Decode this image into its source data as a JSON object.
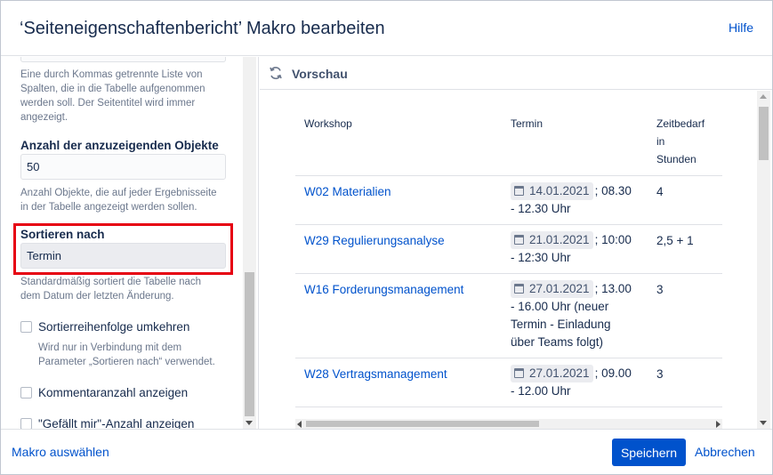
{
  "dialog": {
    "title": "‘Seiteneigenschaftenbericht’ Makro bearbeiten",
    "help": "Hilfe"
  },
  "left": {
    "columns_help_1": "Eine durch Kommas getrennte Liste von",
    "columns_help_2": "Spalten, die in die Tabelle aufgenommen",
    "columns_help_3": "werden soll. Der Seitentitel wird immer",
    "columns_help_4": "angezeigt.",
    "count_label": "Anzahl der anzuzeigenden Objekte",
    "count_value": "50",
    "count_help_1": "Anzahl Objekte, die auf jeder Ergebnisseite",
    "count_help_2": "in der Tabelle angezeigt werden sollen.",
    "sort_label": "Sortieren nach",
    "sort_value": "Termin",
    "sort_help_1": "Standardmäßig sortiert die Tabelle nach",
    "sort_help_2": "dem Datum der letzten Änderung.",
    "reverse_label": "Sortierreihenfolge umkehren",
    "reverse_help_1": "Wird nur in Verbindung mit dem",
    "reverse_help_2": "Parameter „Sortieren nach“ verwendet.",
    "comments_label": "Kommentaranzahl anzeigen",
    "likes_label": "\"Gefällt mir\"-Anzahl anzeigen"
  },
  "preview": {
    "title": "Vorschau",
    "headers": {
      "workshop": "Workshop",
      "termin": "Termin",
      "zeit_1": "Zeitbedarf",
      "zeit_2": "in",
      "zeit_3": "Stunden"
    },
    "rows": [
      {
        "workshop": "W02 Materialien",
        "date": "14.01.2021",
        "rest_1": "; 08.30",
        "rest_2": "- 12.30 Uhr",
        "rest_3": "",
        "rest_4": "",
        "hours": "4"
      },
      {
        "workshop": "W29 Regulierungsanalyse",
        "date": "21.01.2021",
        "rest_1": "; 10:00",
        "rest_2": "- 12:30 Uhr",
        "rest_3": "",
        "rest_4": "",
        "hours": "2,5 + 1"
      },
      {
        "workshop": "W16 Forderungsmanagement",
        "date": "27.01.2021",
        "rest_1": "; 13.00",
        "rest_2": "- 16.00 Uhr (neuer",
        "rest_3": "Termin - Einladung",
        "rest_4": "über Teams folgt)",
        "hours": "3"
      },
      {
        "workshop": "W28 Vertragsmanagement",
        "date": "27.01.2021",
        "rest_1": "; 09.00",
        "rest_2": "- 12.00 Uhr",
        "rest_3": "",
        "rest_4": "",
        "hours": "3"
      }
    ]
  },
  "footer": {
    "select_macro": "Makro auswählen",
    "save": "Speichern",
    "cancel": "Abbrechen"
  }
}
